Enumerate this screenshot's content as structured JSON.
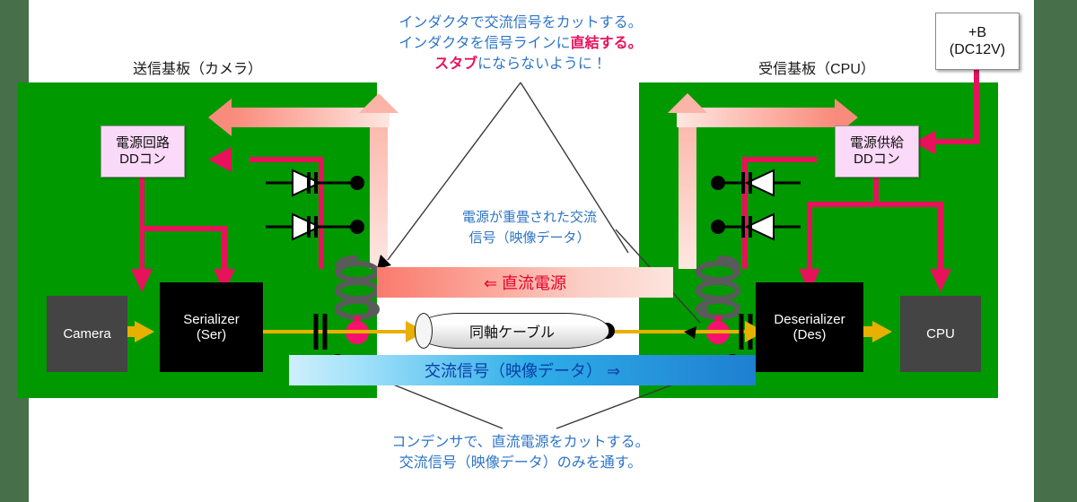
{
  "frame": {
    "border_color": "#47704A",
    "canvas_color": "#ffffff"
  },
  "boards": {
    "left": {
      "label": "送信基板（カメラ）",
      "color": "#009900"
    },
    "right": {
      "label": "受信基板（CPU）",
      "color": "#009900"
    }
  },
  "chips": {
    "camera": "Camera",
    "serializer_line1": "Serializer",
    "serializer_line2": "(Ser)",
    "deserializer_line1": "Deserializer",
    "deserializer_line2": "(Des)",
    "cpu": "CPU"
  },
  "dc_converters": {
    "left_line1": "電源回路",
    "left_line2": "DDコン",
    "right_line1": "電源供給",
    "right_line2": "DDコン",
    "box_color": "#FBD9F8"
  },
  "battery": {
    "line1": "+B",
    "line2": "(DC12V)"
  },
  "cable": {
    "label": "同軸ケーブル"
  },
  "bands": {
    "dc": {
      "label": "⇐ 直流電源",
      "text_color": "#E8002A",
      "from": "#F97A6D",
      "to": "#FDE4DD"
    },
    "ac": {
      "label": "交流信号（映像データ）  ⇒",
      "text_color": "#0B3FA8",
      "from": "#CFEFFB",
      "to": "#1E7FD0"
    }
  },
  "notes": {
    "top_line1": "インダクタで交流信号をカットする。",
    "top_line2_a": "インダクタを信号ラインに",
    "top_line2_b": "直結する。",
    "top_line3_a": "スタブ",
    "top_line3_b": "にならないように！",
    "middle_line1": "電源が重畳された交流",
    "middle_line2": "信号（映像データ）",
    "bottom_line1": "コンデンサで、直流電源をカットする。",
    "bottom_line2": "交流信号（映像データ）のみを通す。"
  },
  "colors": {
    "wire_power": "#E8115B",
    "wire_signal": "#E8B000",
    "inductor": "#5A5A5A",
    "node": "#000000",
    "pink_node": "#F5126E"
  }
}
